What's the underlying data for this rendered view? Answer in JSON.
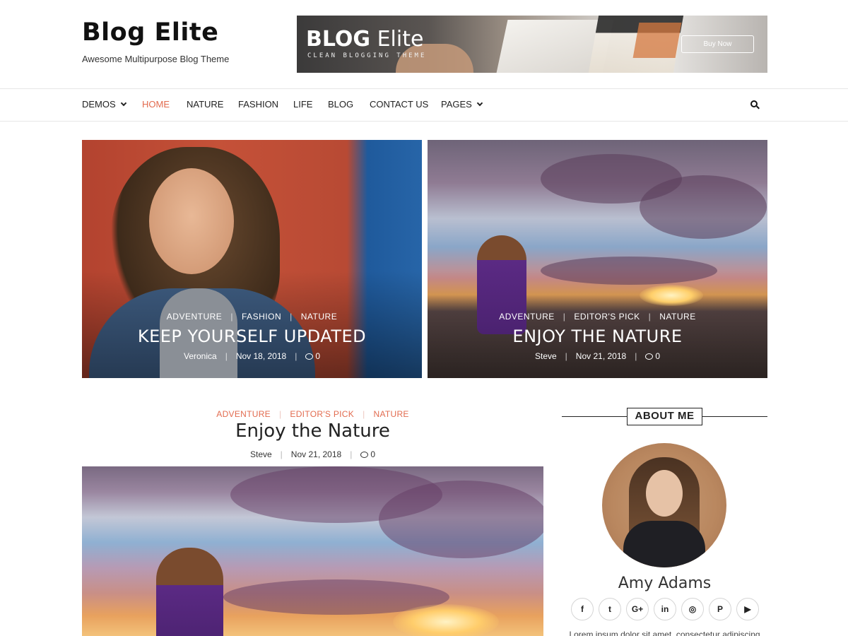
{
  "site": {
    "title": "Blog Elite",
    "tagline": "Awesome Multipurpose Blog Theme"
  },
  "banner": {
    "title_bold": "BLOG",
    "title_rest": " Elite",
    "subtitle": "CLEAN BLOGGING THEME",
    "button": "Buy Now"
  },
  "nav": {
    "items": [
      {
        "label": "DEMOS",
        "dropdown": true
      },
      {
        "label": "HOME",
        "active": true
      },
      {
        "label": "NATURE"
      },
      {
        "label": "FASHION"
      },
      {
        "label": "LIFE"
      },
      {
        "label": "BLOG"
      },
      {
        "label": "CONTACT US"
      },
      {
        "label": "PAGES",
        "dropdown": true
      }
    ],
    "search_icon": "search-icon",
    "active_color": "#e26b4f"
  },
  "featured": [
    {
      "categories": [
        "ADVENTURE",
        "FASHION",
        "NATURE"
      ],
      "title": "KEEP YOURSELF UPDATED",
      "author": "Veronica",
      "date": "Nov 18, 2018",
      "comments": "0"
    },
    {
      "categories": [
        "ADVENTURE",
        "EDITOR'S PICK",
        "NATURE"
      ],
      "title": "ENJOY THE NATURE",
      "author": "Steve",
      "date": "Nov 21, 2018",
      "comments": "0"
    }
  ],
  "post": {
    "categories": [
      "ADVENTURE",
      "EDITOR'S PICK",
      "NATURE"
    ],
    "title": "Enjoy the Nature",
    "author": "Steve",
    "date": "Nov 21, 2018",
    "comments": "0"
  },
  "sidebar": {
    "about_title": "ABOUT ME",
    "author_name": "Amy Adams",
    "socials": [
      {
        "icon": "facebook-icon",
        "glyph": "f"
      },
      {
        "icon": "twitter-icon",
        "glyph": "t"
      },
      {
        "icon": "google-plus-icon",
        "glyph": "G+"
      },
      {
        "icon": "linkedin-icon",
        "glyph": "in"
      },
      {
        "icon": "instagram-icon",
        "glyph": "◎"
      },
      {
        "icon": "pinterest-icon",
        "glyph": "P"
      },
      {
        "icon": "youtube-icon",
        "glyph": "▶"
      }
    ],
    "bio": "Lorem ipsum dolor sit amet, consectetur adipiscing"
  },
  "colors": {
    "accent": "#e26b4f",
    "text": "#222222"
  }
}
